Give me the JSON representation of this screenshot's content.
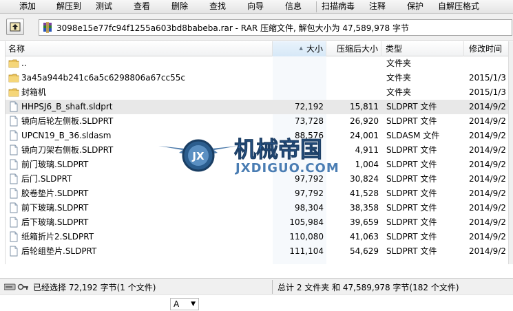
{
  "toolbar": {
    "items": [
      "添加",
      "解压到",
      "测试",
      "查看",
      "删除",
      "查找",
      "向导",
      "信息",
      "扫描病毒",
      "注释",
      "保护",
      "自解压格式"
    ]
  },
  "address": {
    "text": "3098e15e77fc94f1255a603bd8babeba.rar - RAR 压缩文件, 解包大小为 47,589,978 字节"
  },
  "columns": {
    "name": "名称",
    "size": "大小",
    "packed": "压缩后大小",
    "type": "类型",
    "modified": "修改时间"
  },
  "rows": [
    {
      "name": "..",
      "size": "",
      "packed": "",
      "type": "文件夹",
      "modified": "",
      "icon": "folder-icon"
    },
    {
      "name": "3a45a944b241c6a5c6298806a67cc55c",
      "size": "",
      "packed": "",
      "type": "文件夹",
      "modified": "2015/1/3",
      "icon": "folder-icon"
    },
    {
      "name": "封箱机",
      "size": "",
      "packed": "",
      "type": "文件夹",
      "modified": "2015/1/3",
      "icon": "folder-icon"
    },
    {
      "name": "HHPSJ6_B_shaft.sldprt",
      "size": "72,192",
      "packed": "15,811",
      "type": "SLDPRT 文件",
      "modified": "2014/9/2",
      "icon": "file-icon",
      "selected": true
    },
    {
      "name": "镜向后轮左侧板.SLDPRT",
      "size": "73,728",
      "packed": "26,920",
      "type": "SLDPRT 文件",
      "modified": "2014/9/2",
      "icon": "file-icon"
    },
    {
      "name": "UPCN19_B_36.sldasm",
      "size": "88,576",
      "packed": "24,001",
      "type": "SLDASM 文件",
      "modified": "2014/9/2",
      "icon": "file-icon"
    },
    {
      "name": "镜向刀架右侧板.SLDPRT",
      "size": "",
      "packed": "4,911",
      "type": "SLDPRT 文件",
      "modified": "2014/9/2",
      "icon": "file-icon"
    },
    {
      "name": "前门玻璃.SLDPRT",
      "size": "",
      "packed": "1,004",
      "type": "SLDPRT 文件",
      "modified": "2014/9/2",
      "icon": "file-icon"
    },
    {
      "name": "后门.SLDPRT",
      "size": "97,792",
      "packed": "30,824",
      "type": "SLDPRT 文件",
      "modified": "2014/9/2",
      "icon": "file-icon"
    },
    {
      "name": "胶卷垫片.SLDPRT",
      "size": "97,792",
      "packed": "41,528",
      "type": "SLDPRT 文件",
      "modified": "2014/9/2",
      "icon": "file-icon"
    },
    {
      "name": "前下玻璃.SLDPRT",
      "size": "98,304",
      "packed": "38,358",
      "type": "SLDPRT 文件",
      "modified": "2014/9/2",
      "icon": "file-icon"
    },
    {
      "name": "后下玻璃.SLDPRT",
      "size": "105,984",
      "packed": "39,659",
      "type": "SLDPRT 文件",
      "modified": "2014/9/2",
      "icon": "file-icon"
    },
    {
      "name": "纸箱折片2.SLDPRT",
      "size": "110,080",
      "packed": "41,063",
      "type": "SLDPRT 文件",
      "modified": "2014/9/2",
      "icon": "file-icon"
    },
    {
      "name": "后轮组垫片.SLDPRT",
      "size": "111,104",
      "packed": "54,629",
      "type": "SLDPRT 文件",
      "modified": "2014/9/2",
      "icon": "file-icon"
    }
  ],
  "watermark": {
    "title": "机械帝国",
    "url": "JXDIGUO.COM",
    "badge": "JX"
  },
  "status": {
    "left": "已经选择 72,192 字节(1 个文件)",
    "right": "总计 2 文件夹 和 47,589,978 字节(182 个文件)"
  },
  "bottom": {
    "left": "",
    "dropdown": "A"
  }
}
